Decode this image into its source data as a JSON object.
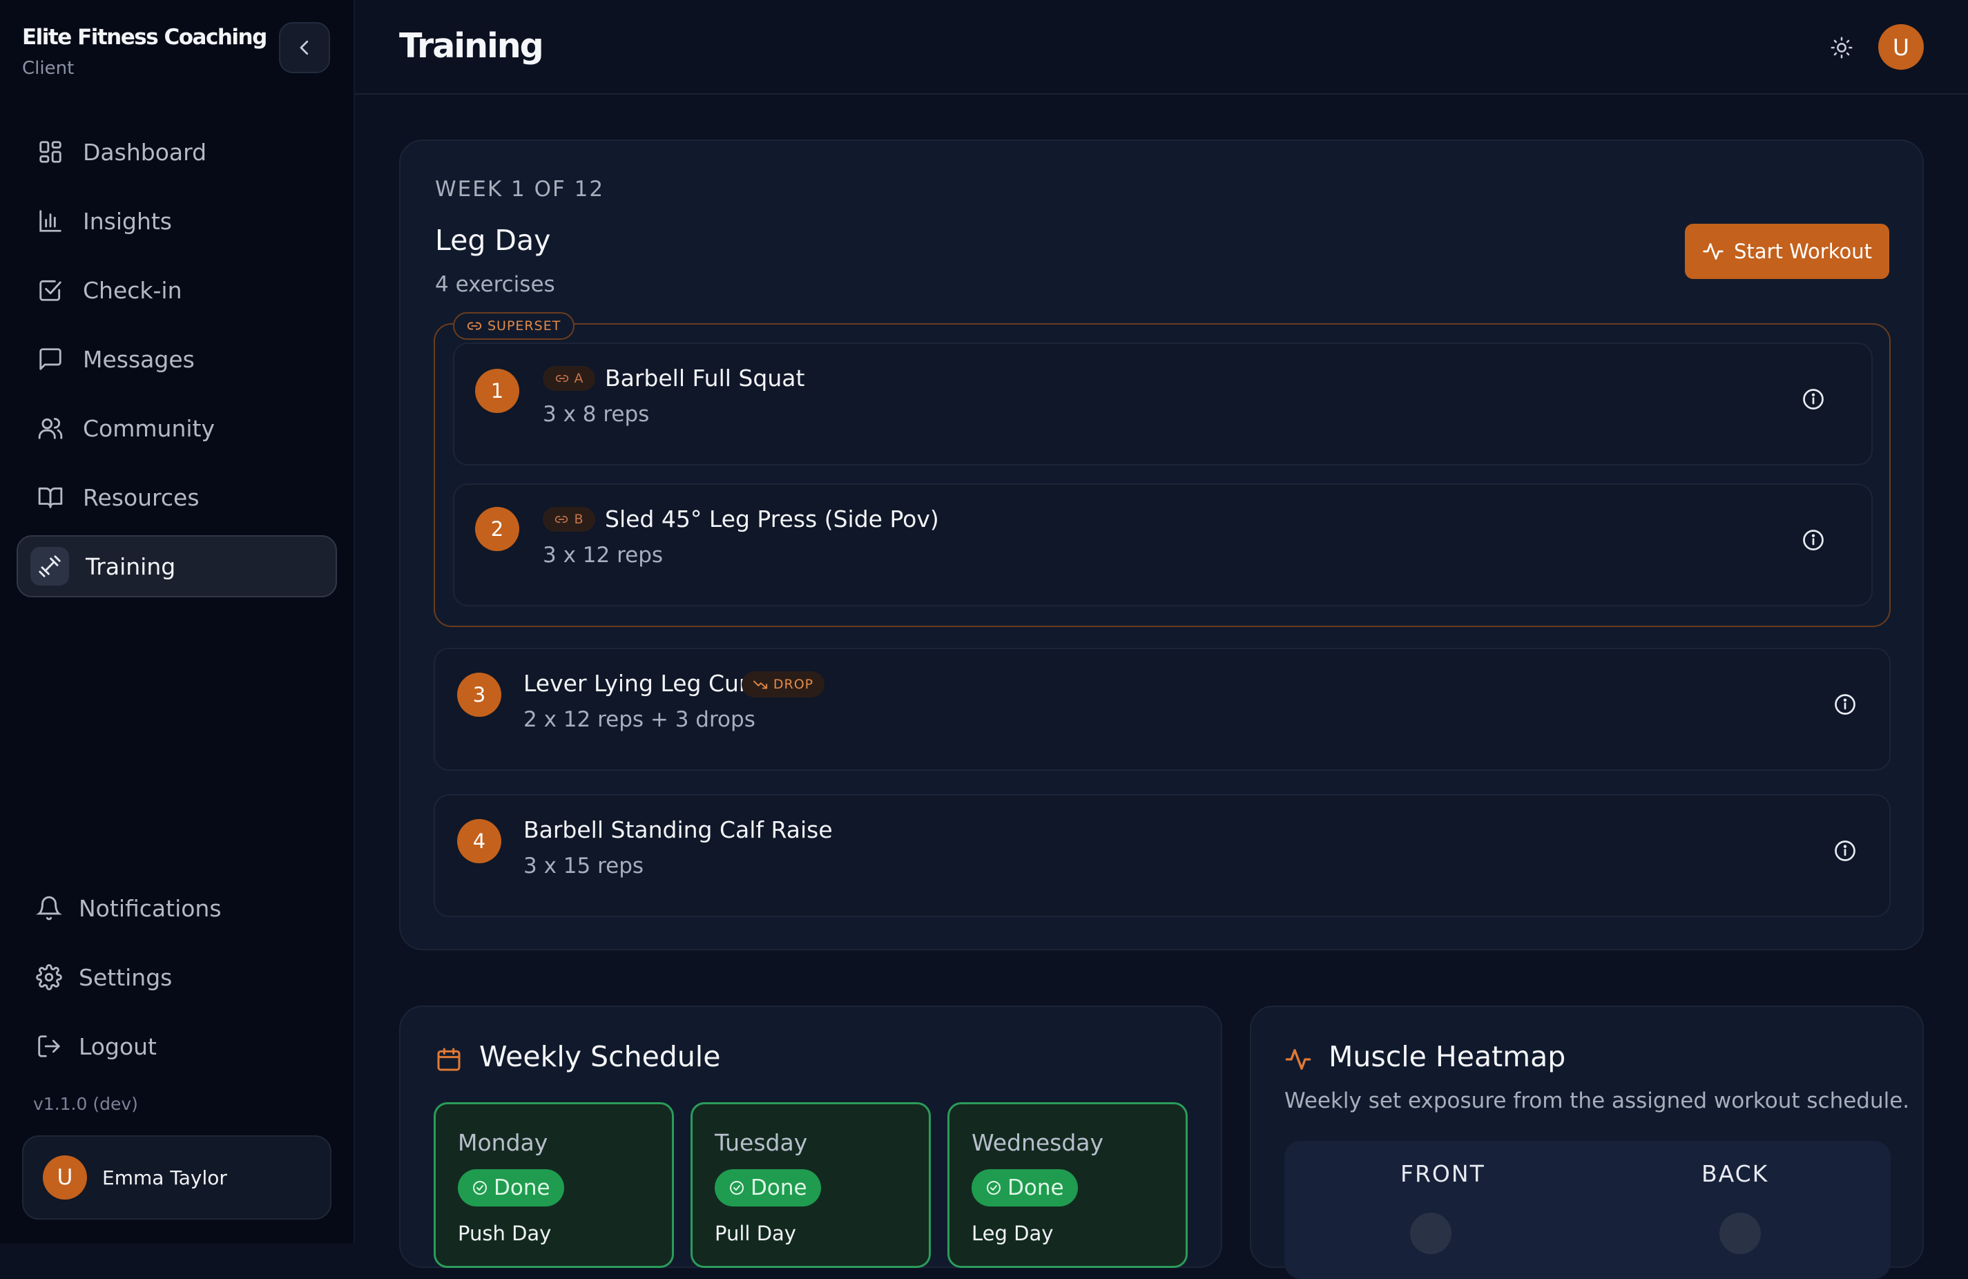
{
  "sidebar": {
    "brand_title": "Elite Fitness Coaching",
    "brand_sub": "Client",
    "items": [
      {
        "label": "Dashboard",
        "icon": "grid-icon"
      },
      {
        "label": "Insights",
        "icon": "bar-chart-icon"
      },
      {
        "label": "Check-in",
        "icon": "check-square-icon"
      },
      {
        "label": "Messages",
        "icon": "message-icon"
      },
      {
        "label": "Community",
        "icon": "users-icon"
      },
      {
        "label": "Resources",
        "icon": "book-icon"
      },
      {
        "label": "Training",
        "icon": "dumbbell-icon",
        "active": true
      }
    ],
    "bottom": [
      {
        "label": "Notifications",
        "icon": "bell-icon"
      },
      {
        "label": "Settings",
        "icon": "gear-icon"
      },
      {
        "label": "Logout",
        "icon": "logout-icon"
      }
    ],
    "version": "v1.1.0 (dev)",
    "user": {
      "initial": "U",
      "name": "Emma Taylor"
    }
  },
  "header": {
    "title": "Training",
    "avatar_initial": "U"
  },
  "workout": {
    "week_label": "WEEK 1 OF 12",
    "day_title": "Leg Day",
    "exercise_count": "4 exercises",
    "start_label": "Start Workout",
    "superset_label": "SUPERSET",
    "drop_label": "DROP",
    "exercises": [
      {
        "num": "1",
        "tag": "A",
        "name": "Barbell Full Squat",
        "detail": "3 x 8 reps"
      },
      {
        "num": "2",
        "tag": "B",
        "name": "Sled 45° Leg Press (Side Pov)",
        "detail": "3 x 12 reps"
      },
      {
        "num": "3",
        "name": "Lever Lying Leg Curl",
        "detail": "2 x 12 reps + 3 drops"
      },
      {
        "num": "4",
        "name": "Barbell Standing Calf Raise",
        "detail": "3 x 15 reps"
      }
    ]
  },
  "schedule": {
    "title": "Weekly Schedule",
    "days": [
      {
        "day": "Monday",
        "status": "Done",
        "workout": "Push Day"
      },
      {
        "day": "Tuesday",
        "status": "Done",
        "workout": "Pull Day"
      },
      {
        "day": "Wednesday",
        "status": "Done",
        "workout": "Leg Day"
      }
    ]
  },
  "heatmap": {
    "title": "Muscle Heatmap",
    "subtitle": "Weekly set exposure from the assigned workout schedule.",
    "front_label": "FRONT",
    "back_label": "BACK"
  },
  "colors": {
    "accent": "#c4611c",
    "done": "#1f9c4f",
    "background": "#0b1120"
  }
}
